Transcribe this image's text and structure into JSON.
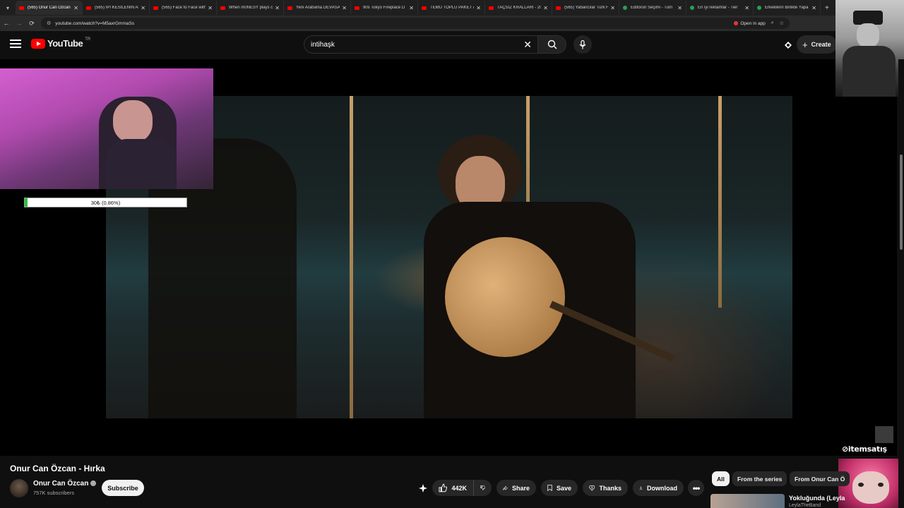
{
  "browser": {
    "tabs": [
      {
        "title": "(565) Onur Can Özcan",
        "active": true,
        "fav": "youtube"
      },
      {
        "title": "(565) İPİ KESİLENİN AF",
        "fav": "youtube"
      },
      {
        "title": "(565) Face to Face with",
        "fav": "youtube"
      },
      {
        "title": "When m0NESY plays c",
        "fav": "youtube"
      },
      {
        "title": "Yeni Arabama DEVASA",
        "fav": "youtube"
      },
      {
        "title": "90s Tokyo Fireplace D",
        "fav": "youtube"
      },
      {
        "title": "TEMU TOPLU PAKET A",
        "fav": "youtube"
      },
      {
        "title": "TAÇSIZ KRALLARI - 20",
        "fav": "youtube"
      },
      {
        "title": "(565) Yabancılar Türk F",
        "fav": "youtube"
      },
      {
        "title": "Editörün Seçimi - Turn",
        "fav": "green"
      },
      {
        "title": "En iyi reklamlar - Tier",
        "fav": "green"
      },
      {
        "title": "Erkeklerin Birlikte Yapa",
        "fav": "green"
      }
    ],
    "url": "youtube.com/watch?v=M5axrGmmaSs",
    "open_in_app": "Open in app"
  },
  "youtube": {
    "logo_text": "YouTube",
    "country_code": "TR",
    "search_value": "intihaşk",
    "create_label": "Create"
  },
  "overlay": {
    "progress_text": "30₺ (0.86%)",
    "progress_fraction": 0.0086,
    "brand_text": "itemsatış"
  },
  "video": {
    "title": "Onur Can Özcan - Hırka",
    "channel": "Onur Can Özcan",
    "subscribers": "757K subscribers",
    "subscribe_label": "Subscribe",
    "likes": "442K",
    "share_label": "Share",
    "save_label": "Save",
    "thanks_label": "Thanks",
    "download_label": "Download"
  },
  "chips": [
    {
      "label": "All",
      "active": true
    },
    {
      "label": "From the series"
    },
    {
      "label": "From Onur Can Ö"
    }
  ],
  "next_video": {
    "title": "Yokluğunda (Leyla",
    "channel": "LeylaTheBand"
  },
  "colors": {
    "youtube_red": "#ff0000",
    "background": "#0f0f0f",
    "progress_green": "#26c33b"
  }
}
